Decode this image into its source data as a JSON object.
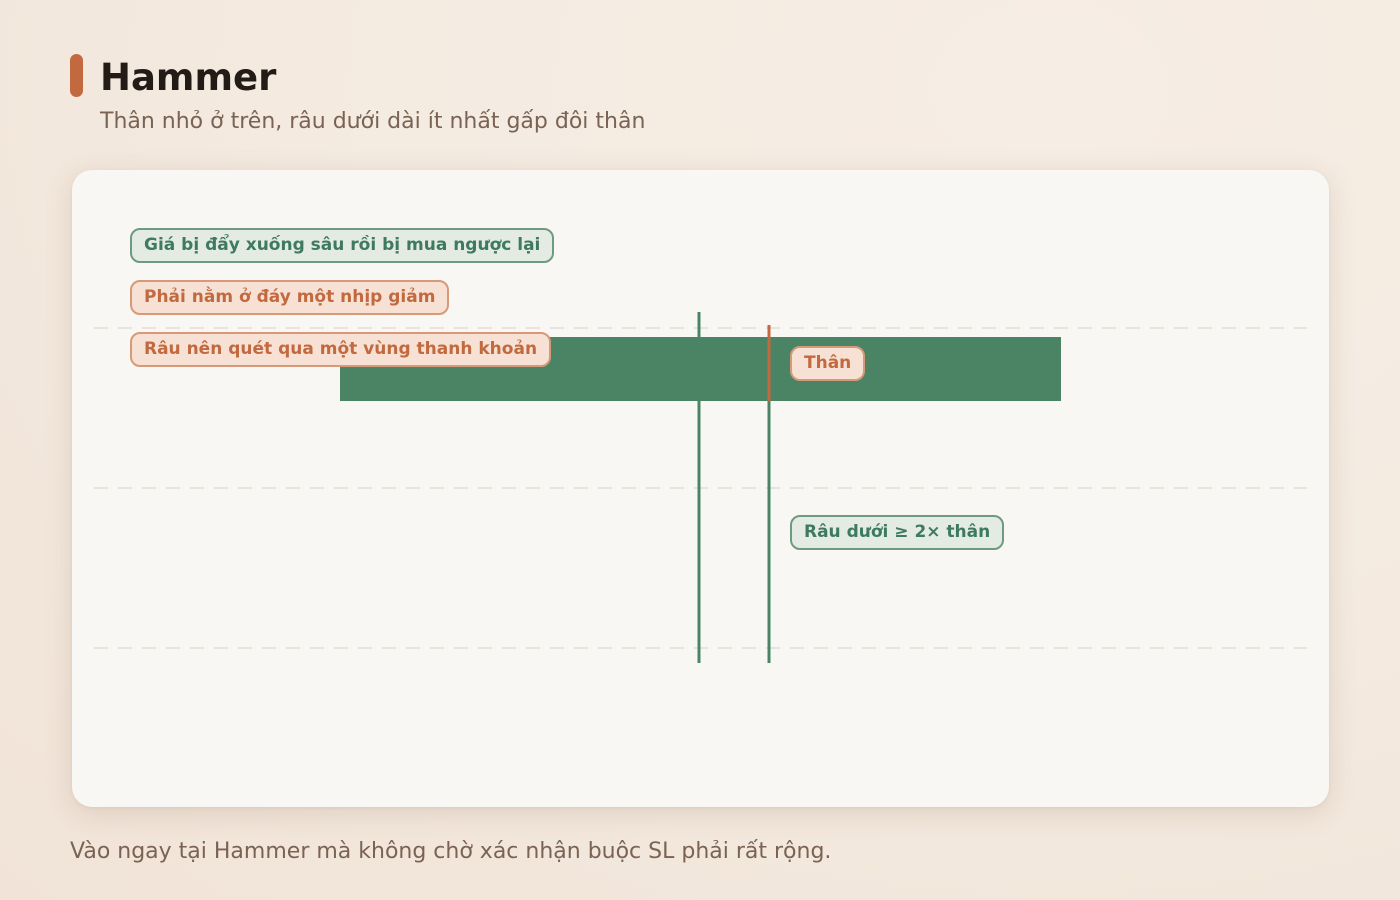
{
  "header": {
    "title": "Hammer",
    "subtitle": "Thân nhỏ ở trên, râu dưới dài ít nhất gấp đôi thân"
  },
  "notes": [
    "Giá bị đẩy xuống sâu rồi bị mua ngược lại",
    "Phải nằm ở đáy một nhịp giảm",
    "Râu nên quét qua một vùng thanh khoản"
  ],
  "labels": {
    "body": "Thân",
    "lower_wick": "Râu dưới ≥ 2× thân"
  },
  "footer": {
    "text": "Vào ngay tại Hammer mà không chờ xác nhận buộc SL phải rất rộng."
  },
  "colors": {
    "bull": "#4a8465",
    "accent": "#c2693f",
    "grid": "#e2ddd6"
  }
}
